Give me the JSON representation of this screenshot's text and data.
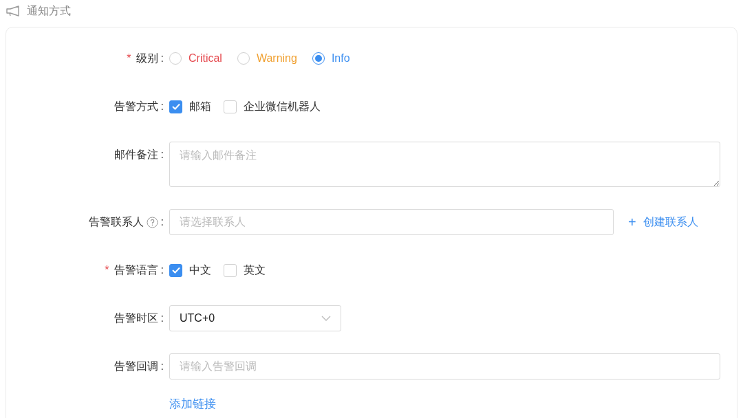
{
  "section": {
    "title": "通知方式"
  },
  "fields": [
    {
      "kind": "radio",
      "required_mark": "*",
      "label": "级别",
      "colon": ":",
      "options": [
        {
          "label": "Critical",
          "color": "#e5484d",
          "selected": false
        },
        {
          "label": "Warning",
          "color": "#f0a030",
          "selected": false
        },
        {
          "label": "Info",
          "color": "#3b8ef0",
          "selected": true
        }
      ]
    },
    {
      "kind": "checkbox",
      "label": "告警方式",
      "colon": ":",
      "options": [
        {
          "label": "邮箱",
          "checked": true
        },
        {
          "label": "企业微信机器人",
          "checked": false
        }
      ]
    },
    {
      "kind": "textarea",
      "label": "邮件备注",
      "colon": ":",
      "placeholder": "请输入邮件备注"
    },
    {
      "kind": "input",
      "label": "告警联系人",
      "help": true,
      "colon": ":",
      "placeholder": "请选择联系人",
      "action": {
        "icon": "+",
        "label": "创建联系人"
      }
    },
    {
      "kind": "checkbox",
      "required_mark": "*",
      "label": "告警语言",
      "colon": ":",
      "options": [
        {
          "label": "中文",
          "checked": true
        },
        {
          "label": "英文",
          "checked": false
        }
      ]
    },
    {
      "kind": "select",
      "label": "告警时区",
      "colon": ":",
      "value": "UTC+0"
    },
    {
      "kind": "wide-input",
      "label": "告警回调",
      "colon": ":",
      "placeholder": "请输入告警回调",
      "link": "添加链接"
    }
  ]
}
